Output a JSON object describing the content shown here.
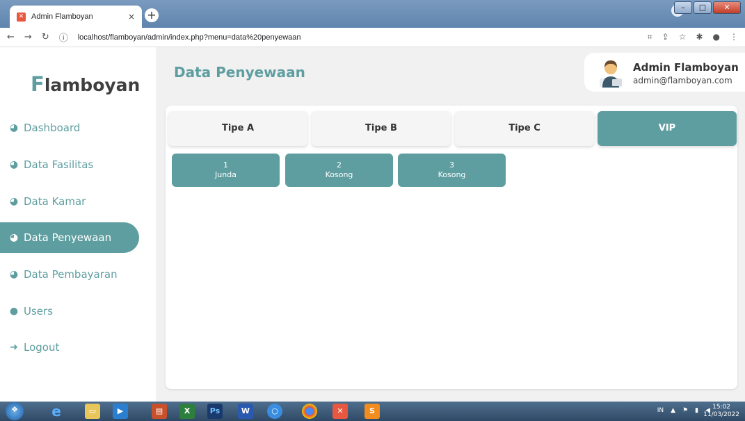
{
  "browser": {
    "tab_title": "Admin Flamboyan",
    "tab_close": "×",
    "new_tab": "+",
    "url_host": "localhost",
    "url_path": "/flamboyan/admin/index.php?menu=data%20penyewaan",
    "info_icon": "ⓘ"
  },
  "brand": {
    "first_letter": "F",
    "rest": "lamboyan"
  },
  "sidebar": {
    "items": [
      {
        "label": "Dashboard",
        "icon": "tachometer-icon"
      },
      {
        "label": "Data Fasilitas",
        "icon": "tachometer-icon"
      },
      {
        "label": "Data Kamar",
        "icon": "tachometer-icon"
      },
      {
        "label": "Data Penyewaan",
        "icon": "tachometer-icon",
        "active": true
      },
      {
        "label": "Data Pembayaran",
        "icon": "tachometer-icon"
      },
      {
        "label": "Users",
        "icon": "user-icon"
      },
      {
        "label": "Logout",
        "icon": "sign-out-icon"
      }
    ]
  },
  "header": {
    "title": "Data Penyewaan",
    "user_name": "Admin Flamboyan",
    "user_email": "admin@flamboyan.com"
  },
  "room_types": [
    {
      "label": "Tipe A",
      "active": false
    },
    {
      "label": "Tipe B",
      "active": false
    },
    {
      "label": "Tipe C",
      "active": false
    },
    {
      "label": "VIP",
      "active": true
    }
  ],
  "rooms": [
    {
      "number": "1",
      "tenant": "Junda"
    },
    {
      "number": "2",
      "tenant": "Kosong"
    },
    {
      "number": "3",
      "tenant": "Kosong"
    }
  ],
  "taskbar": {
    "tray_lang": "IN",
    "time": "15:02",
    "date": "11/03/2022"
  },
  "colors": {
    "accent": "#5f9ea0",
    "text_dark": "#333333",
    "background": "#f1f1f1"
  }
}
